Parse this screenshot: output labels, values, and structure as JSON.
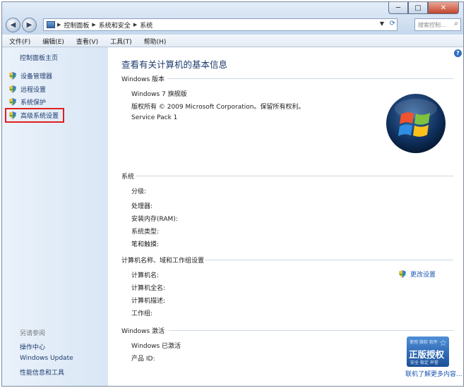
{
  "window": {
    "buttons": {
      "minimize": "─",
      "maximize": "□",
      "close": "✕"
    }
  },
  "nav": {
    "back": "◀",
    "forward": "▶"
  },
  "address": {
    "segments": [
      "控制面板",
      "系统和安全",
      "系统"
    ]
  },
  "search": {
    "placeholder": "搜索控制..."
  },
  "menu": [
    "文件(F)",
    "编辑(E)",
    "查看(V)",
    "工具(T)",
    "帮助(H)"
  ],
  "sidebar": {
    "home": "控制面板主页",
    "tasks": [
      "设备管理器",
      "远程设置",
      "系统保护",
      "高级系统设置"
    ],
    "see_also_title": "另请参阅",
    "see_also": [
      "操作中心",
      "Windows Update",
      "性能信息和工具"
    ]
  },
  "main": {
    "heading": "查看有关计算机的基本信息",
    "edition": {
      "title": "Windows 版本",
      "name": "Windows 7 旗舰版",
      "copyright": "版权所有 © 2009 Microsoft Corporation。保留所有权利。",
      "service_pack": "Service Pack 1"
    },
    "system": {
      "title": "系统",
      "labels": [
        "分级:",
        "处理器:",
        "安装内存(RAM):",
        "系统类型:",
        "笔和触摸:"
      ]
    },
    "computer": {
      "title": "计算机名称、域和工作组设置",
      "labels": [
        "计算机名:",
        "计算机全名:",
        "计算机描述:",
        "工作组:"
      ],
      "change_link": "更改设置"
    },
    "activation": {
      "title": "Windows 激活",
      "status": "Windows 已激活",
      "product_id": "产品 ID:",
      "badge_top": "使用 微软 软件",
      "badge_main": "正版授权",
      "badge_bottom": "安全 稳定 声誉",
      "more_link": "联机了解更多内容..."
    }
  },
  "colors": {
    "accent_red": "#e0201c",
    "link": "#1d57b3",
    "heading": "#1e3b6e"
  }
}
